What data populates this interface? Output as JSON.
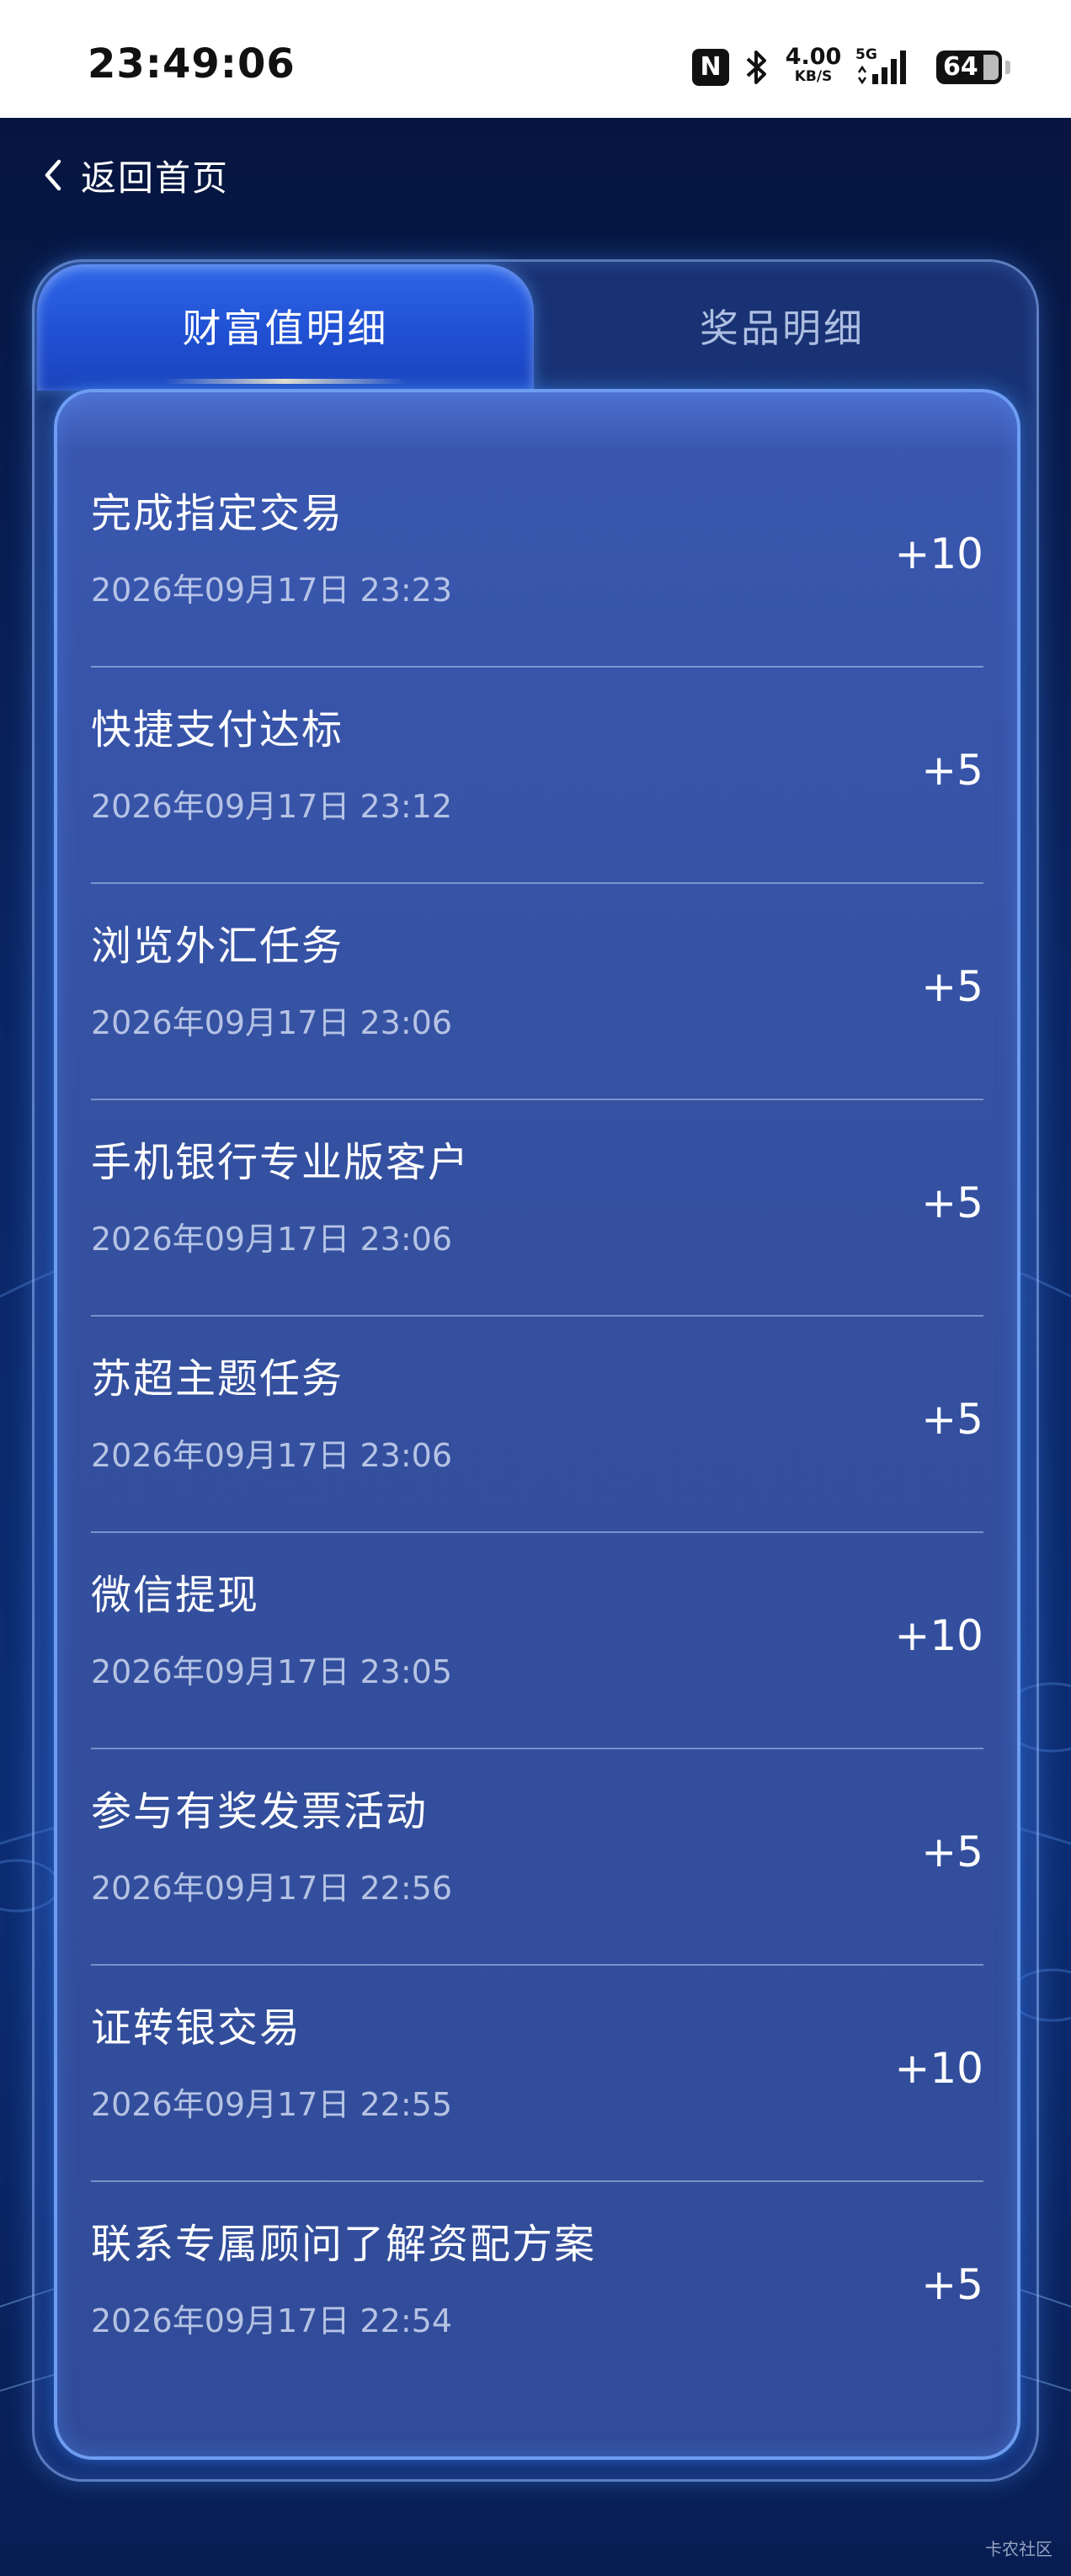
{
  "status_bar": {
    "time": "23:49:06",
    "nfc_glyph": "N",
    "network_speed": "4.00",
    "network_speed_unit": "KB/S",
    "network_type": "5G",
    "battery": "64",
    "icons": [
      "nfc-icon",
      "bluetooth-icon",
      "signal-icon",
      "battery-icon"
    ]
  },
  "header": {
    "back_label": "返回首页",
    "back_icon": "chevron-left-icon"
  },
  "tabs": [
    {
      "label": "财富值明细",
      "active": true
    },
    {
      "label": "奖品明细",
      "active": false
    }
  ],
  "records": [
    {
      "title": "完成指定交易",
      "time": "2026年09月17日 23:23",
      "points": "+10"
    },
    {
      "title": "快捷支付达标",
      "time": "2026年09月17日 23:12",
      "points": "+5"
    },
    {
      "title": "浏览外汇任务",
      "time": "2026年09月17日 23:06",
      "points": "+5"
    },
    {
      "title": "手机银行专业版客户",
      "time": "2026年09月17日 23:06",
      "points": "+5"
    },
    {
      "title": "苏超主题任务",
      "time": "2026年09月17日 23:06",
      "points": "+5"
    },
    {
      "title": "微信提现",
      "time": "2026年09月17日 23:05",
      "points": "+10"
    },
    {
      "title": "参与有奖发票活动",
      "time": "2026年09月17日 22:56",
      "points": "+5"
    },
    {
      "title": "证转银交易",
      "time": "2026年09月17日 22:55",
      "points": "+10"
    },
    {
      "title": "联系专属顾问了解资配方案",
      "time": "2026年09月17日 22:54",
      "points": "+5"
    }
  ],
  "watermark": "卡农社区",
  "colors": {
    "background": "#0a2563",
    "panel": "#34509f",
    "active_tab": "#1f4ed0",
    "divider": "#b4c8f0"
  }
}
